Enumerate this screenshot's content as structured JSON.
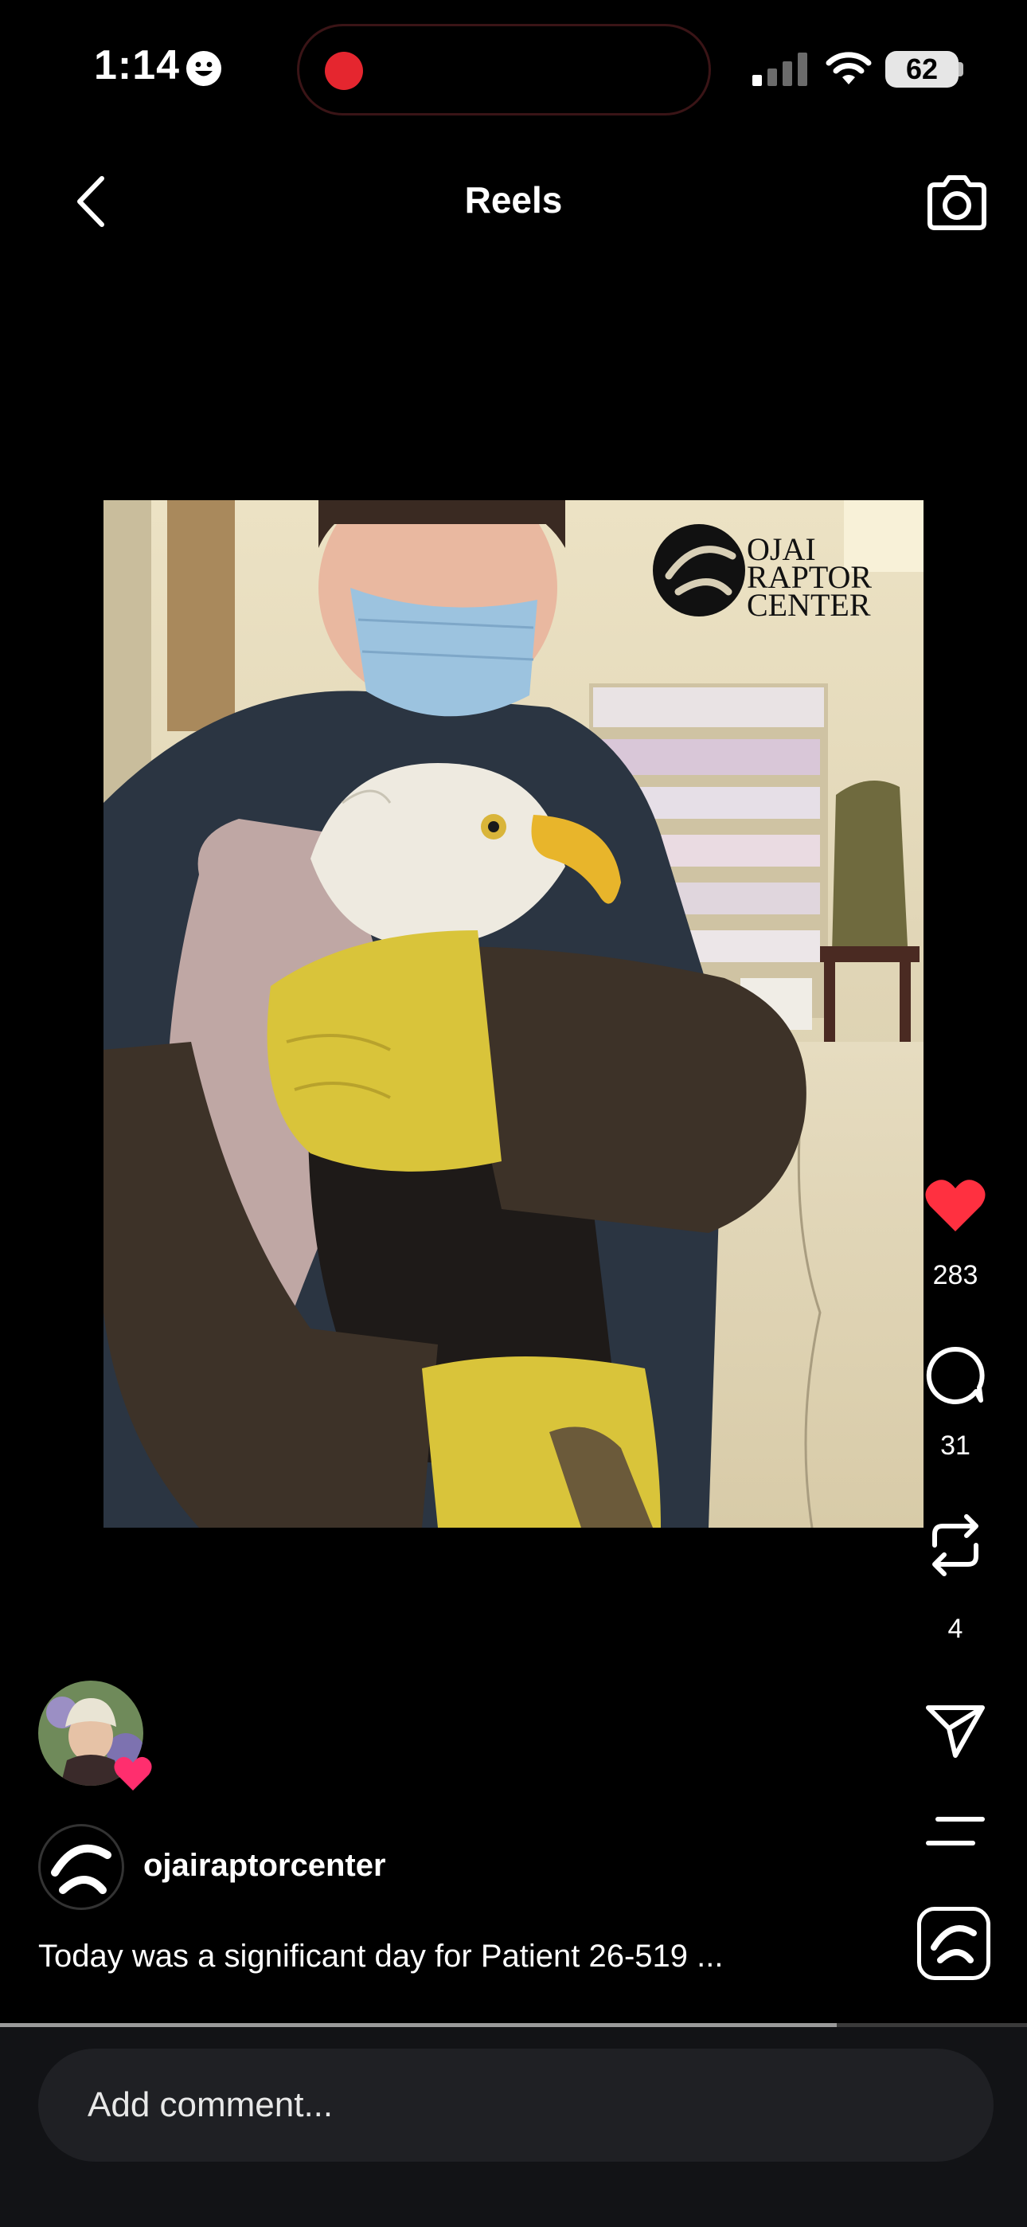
{
  "status_bar": {
    "time": "1:14",
    "battery_level": "62",
    "focus_icon": "smiley-face-icon",
    "recording_indicator": "red-dot-icon"
  },
  "header": {
    "title": "Reels",
    "back_icon": "chevron-left-icon",
    "camera_icon": "camera-icon"
  },
  "media": {
    "watermark_lines": [
      "OJAI",
      "RAPTOR",
      "CENTER"
    ]
  },
  "actions": {
    "like_count": "283",
    "comment_count": "31",
    "repost_count": "4",
    "like_color": "#ff3040"
  },
  "post": {
    "username": "ojairaptorcenter",
    "caption": "Today was a significant day for Patient 26-519 ...",
    "progress": 0.815
  },
  "comment": {
    "placeholder": "Add comment..."
  }
}
